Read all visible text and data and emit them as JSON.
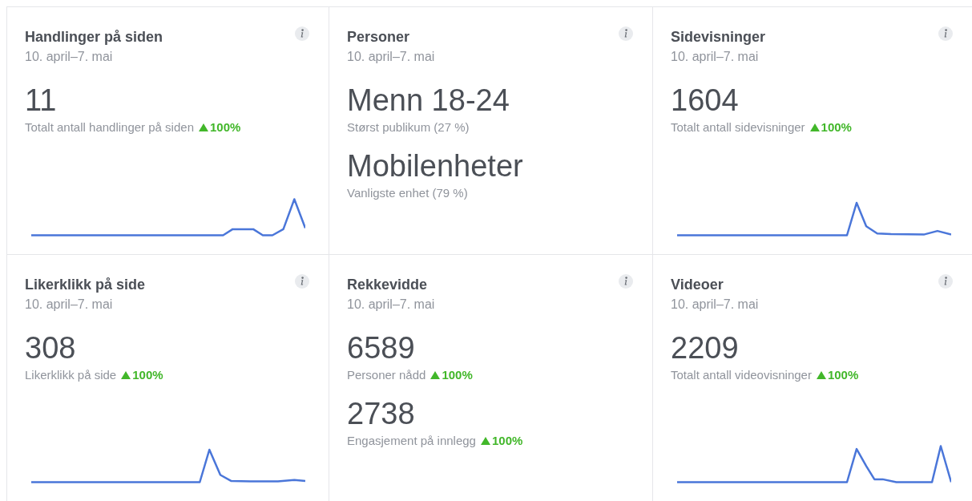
{
  "cards": [
    {
      "title": "Handlinger på siden",
      "date": "10. april–7. mai",
      "sparkline": true,
      "metrics": [
        {
          "value": "11",
          "label": "Totalt antall handlinger på siden",
          "rising": true,
          "change": "100%"
        }
      ]
    },
    {
      "title": "Personer",
      "date": "10. april–7. mai",
      "sparkline": false,
      "metrics": [
        {
          "value": "Menn 18-24",
          "label": "Størst publikum (27 %)"
        },
        {
          "value": "Mobilenheter",
          "label": "Vanligste enhet (79 %)"
        }
      ]
    },
    {
      "title": "Sidevisninger",
      "date": "10. april–7. mai",
      "sparkline": true,
      "metrics": [
        {
          "value": "1604",
          "label": "Totalt antall sidevisninger",
          "rising": true,
          "change": "100%"
        }
      ]
    },
    {
      "title": "Likerklikk på side",
      "date": "10. april–7. mai",
      "sparkline": true,
      "metrics": [
        {
          "value": "308",
          "label": "Likerklikk på side",
          "rising": true,
          "change": "100%"
        }
      ]
    },
    {
      "title": "Rekkevidde",
      "date": "10. april–7. mai",
      "sparkline": false,
      "metrics": [
        {
          "value": "6589",
          "label": "Personer nådd",
          "rising": true,
          "change": "100%"
        },
        {
          "value": "2738",
          "label": "Engasjement på innlegg",
          "rising": true,
          "change": "100%"
        }
      ]
    },
    {
      "title": "Videoer",
      "date": "10. april–7. mai",
      "sparkline": true,
      "metrics": [
        {
          "value": "2209",
          "label": "Totalt antall videovisninger",
          "rising": true,
          "change": "100%"
        }
      ]
    }
  ]
}
